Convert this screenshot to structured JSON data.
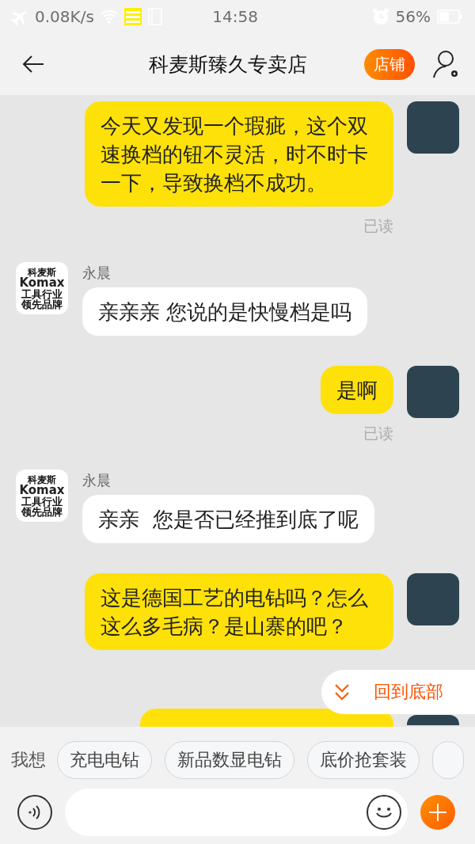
{
  "status_bar": {
    "speed": "0.08K/s",
    "time": "14:58",
    "battery": "56%"
  },
  "header": {
    "title": "科麦斯臻久专卖店",
    "store_button": "店铺"
  },
  "messages": [
    {
      "kind": "sent",
      "text": "今天又发现一个瑕疵，这个双速换档的钮不灵活，时不时卡一下，导致换档不成功。",
      "read": "已读"
    },
    {
      "kind": "received",
      "sender": "永晨",
      "logo": [
        "科麦斯",
        "Komax",
        "工具行业",
        "领先品牌"
      ],
      "text": "亲亲亲 您说的是快慢档是吗"
    },
    {
      "kind": "sent",
      "text": "是啊",
      "read": "已读"
    },
    {
      "kind": "received",
      "sender": "永晨",
      "logo": [
        "科麦斯",
        "Komax",
        "工具行业",
        "领先品牌"
      ],
      "text": "亲亲  您是否已经推到底了呢"
    },
    {
      "kind": "sent",
      "text": "这是德国工艺的电钻吗？怎么这么多毛病？是山寨的吧？"
    },
    {
      "kind": "sent_hidden"
    }
  ],
  "back_to_bottom": "回到底部",
  "quick_replies": {
    "label": "我想",
    "chips": [
      "充电电钻",
      "新品数显电钻",
      "底价抢套装"
    ],
    "cut_chip": true
  }
}
